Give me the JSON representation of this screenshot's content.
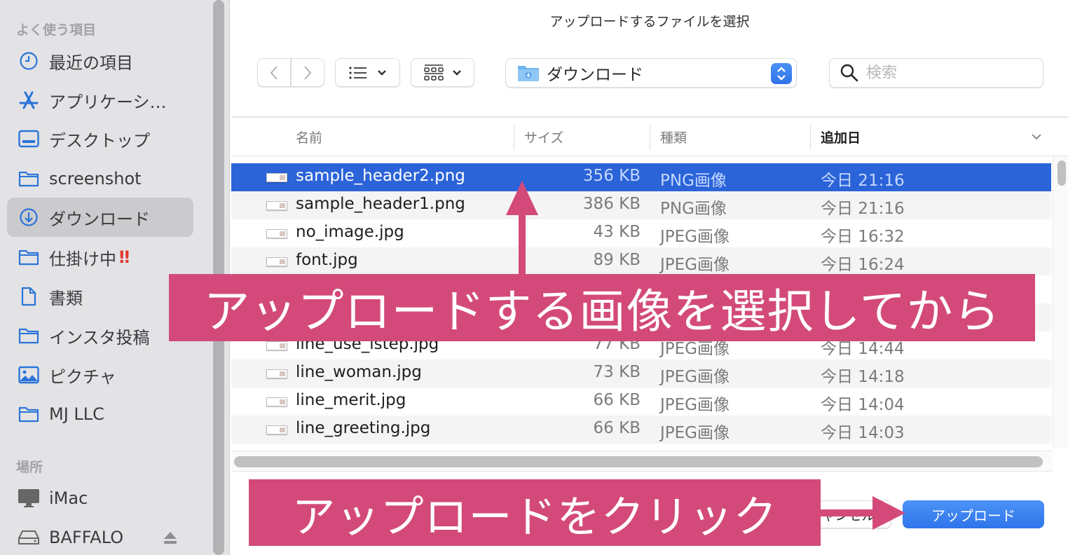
{
  "dialog": {
    "title": "アップロードするファイルを選択"
  },
  "sidebar": {
    "favorites_heading": "よく使う項目",
    "favorites": [
      {
        "label": "最近の項目",
        "icon": "clock-icon"
      },
      {
        "label": "アプリケーシ…",
        "icon": "applications-icon"
      },
      {
        "label": "デスクトップ",
        "icon": "desktop-icon"
      },
      {
        "label": "screenshot",
        "icon": "folder-icon"
      },
      {
        "label": "ダウンロード",
        "icon": "download-icon",
        "active": true
      },
      {
        "label": "仕掛け中",
        "icon": "folder-icon",
        "badge": "‼"
      },
      {
        "label": "書類",
        "icon": "document-icon"
      },
      {
        "label": "インスタ投稿",
        "icon": "folder-icon"
      },
      {
        "label": "ピクチャ",
        "icon": "pictures-icon"
      },
      {
        "label": "MJ LLC",
        "icon": "folder-icon"
      }
    ],
    "locations_heading": "場所",
    "locations": [
      {
        "label": "iMac",
        "icon": "imac-icon"
      },
      {
        "label": "BAFFALO",
        "icon": "drive-icon",
        "ejectable": true
      }
    ]
  },
  "toolbar": {
    "back": "‹",
    "forward": "›",
    "location": "ダウンロード",
    "search_placeholder": "検索",
    "search_value": ""
  },
  "columns": {
    "name": "名前",
    "size": "サイズ",
    "kind": "種類",
    "date_added": "追加日",
    "sorted_by": "date_added"
  },
  "files": [
    {
      "name": "sample_header2.png",
      "size": "356 KB",
      "kind": "PNG画像",
      "date": "今日 21:16",
      "selected": true
    },
    {
      "name": "sample_header1.png",
      "size": "386 KB",
      "kind": "PNG画像",
      "date": "今日 21:16"
    },
    {
      "name": "no_image.jpg",
      "size": "43 KB",
      "kind": "JPEG画像",
      "date": "今日 16:32"
    },
    {
      "name": "font.jpg",
      "size": "89 KB",
      "kind": "JPEG画像",
      "date": "今日 16:24"
    },
    {
      "name": "",
      "size": "",
      "kind": "",
      "date": ""
    },
    {
      "name": "",
      "size": "",
      "kind": "",
      "date": ""
    },
    {
      "name": "line_use_lstep.jpg",
      "size": "77 KB",
      "kind": "JPEG画像",
      "date": "今日 14:44"
    },
    {
      "name": "line_woman.jpg",
      "size": "73 KB",
      "kind": "JPEG画像",
      "date": "今日 14:18"
    },
    {
      "name": "line_merit.jpg",
      "size": "66 KB",
      "kind": "JPEG画像",
      "date": "今日 14:04"
    },
    {
      "name": "line_greeting.jpg",
      "size": "66 KB",
      "kind": "JPEG画像",
      "date": "今日 14:03"
    }
  ],
  "footer": {
    "cancel_label": "キャンセル",
    "upload_label": "アップロード"
  },
  "annotations": {
    "select_banner": "アップロードする画像を選択してから",
    "click_banner": "アップロードをクリック",
    "color": "#d34a7a"
  },
  "colors": {
    "selection": "#2b63d8",
    "accent": "#3580f0",
    "sidebar_icon": "#2a74d8"
  }
}
